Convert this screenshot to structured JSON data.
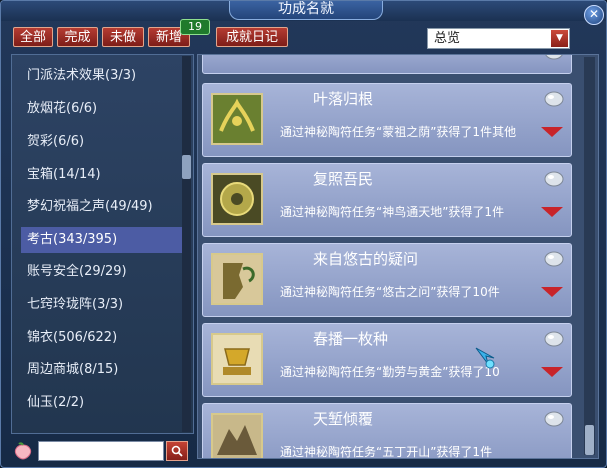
{
  "window": {
    "title": "功成名就"
  },
  "tabs": [
    {
      "label": "全部"
    },
    {
      "label": "完成"
    },
    {
      "label": "未做"
    },
    {
      "label": "新增"
    },
    {
      "label": "成就日记"
    }
  ],
  "new_count": "19",
  "filter": {
    "selected": "总览"
  },
  "categories": [
    {
      "label": "门派法术效果(3/3)"
    },
    {
      "label": "放烟花(6/6)"
    },
    {
      "label": "贺彩(6/6)"
    },
    {
      "label": "宝箱(14/14)"
    },
    {
      "label": "梦幻祝福之声(49/49)"
    },
    {
      "label": "考古(343/395)"
    },
    {
      "label": "账号安全(29/29)"
    },
    {
      "label": "七窍玲珑阵(3/3)"
    },
    {
      "label": "锦衣(506/622)"
    },
    {
      "label": "周边商城(8/15)"
    },
    {
      "label": "仙玉(2/2)"
    }
  ],
  "search": {
    "value": ""
  },
  "achievements": [
    {
      "name": "叶落归根",
      "desc": "通过神秘陶符任务“蒙祖之荫”获得了1件其他"
    },
    {
      "name": "复照吾民",
      "desc": "通过神秘陶符任务“神鸟通天地”获得了1件"
    },
    {
      "name": "来自悠古的疑问",
      "desc": "通过神秘陶符任务“悠古之问”获得了10件"
    },
    {
      "name": "春播一枚种",
      "desc": "通过神秘陶符任务“勤劳与黄金”获得了10"
    },
    {
      "name": "天堑倾覆",
      "desc": "通过神秘陶符任务“五丁开山”获得了1件"
    }
  ],
  "colors": {
    "tab_red": "#9a2a22",
    "selected_category": "#4c5ca4",
    "card_bg": "#95a3cc",
    "expand_arrow": "#c8242a"
  },
  "icons": {
    "close": "close-icon",
    "search": "search-icon",
    "expand": "expand-arrow-icon",
    "pearl": "pearl-icon",
    "peach": "peach-icon",
    "dropdown": "dropdown-arrow-icon"
  }
}
